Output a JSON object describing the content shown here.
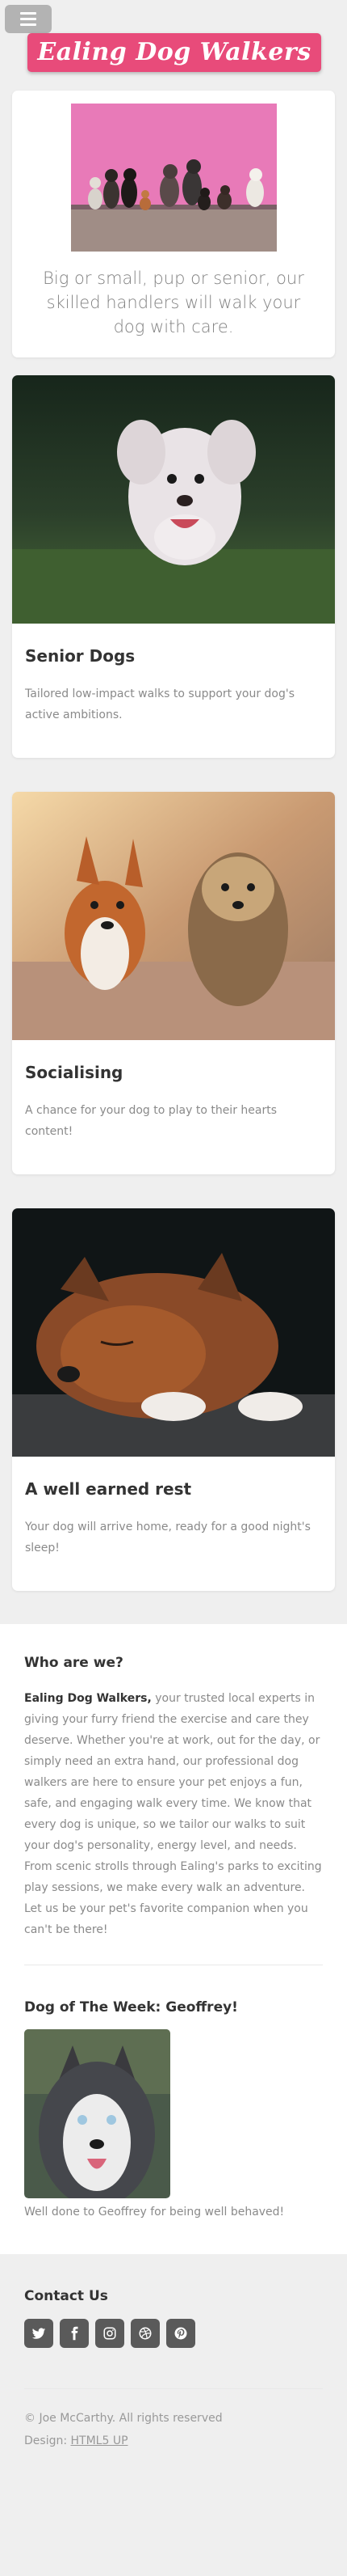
{
  "header": {
    "site_title": "Ealing Dog Walkers"
  },
  "hero": {
    "tagline": "Big or small, pup or senior, our skilled handlers will walk your dog with care."
  },
  "features": [
    {
      "title": "Senior Dogs",
      "description": "Tailored low-impact walks to support your dog's active ambitions."
    },
    {
      "title": "Socialising",
      "description": "A chance for your dog to play to their hearts content!"
    },
    {
      "title": "A well earned rest",
      "description": "Your dog will arrive home, ready for a good night's sleep!"
    }
  ],
  "about": {
    "heading": "Who are we?",
    "brand": "Ealing Dog Walkers,",
    "body": " your trusted local experts in giving your furry friend the exercise and care they deserve. Whether you're at work, out for the day, or simply need an extra hand, our professional dog walkers are here to ensure your pet enjoys a fun, safe, and engaging walk every time. We know that every dog is unique, so we tailor our walks to suit your dog's personality, energy level, and needs. From scenic strolls through Ealing's parks to exciting play sessions, we make every walk an adventure. Let us be your pet's favorite companion when you can't be there!"
  },
  "dog_of_week": {
    "heading": "Dog of The Week: Geoffrey!",
    "caption": "Well done to Geoffrey for being well behaved!"
  },
  "footer": {
    "contact_heading": "Contact Us",
    "social_icons": [
      "twitter-icon",
      "facebook-icon",
      "instagram-icon",
      "dribbble-icon",
      "pinterest-icon"
    ],
    "copyright": "© Joe McCarthy. All rights reserved",
    "design_label": "Design: ",
    "design_link": "HTML5 UP"
  },
  "colors": {
    "brand_pink": "#e84b7a",
    "background": "#efefef",
    "icon_button": "#5a5a5a"
  }
}
